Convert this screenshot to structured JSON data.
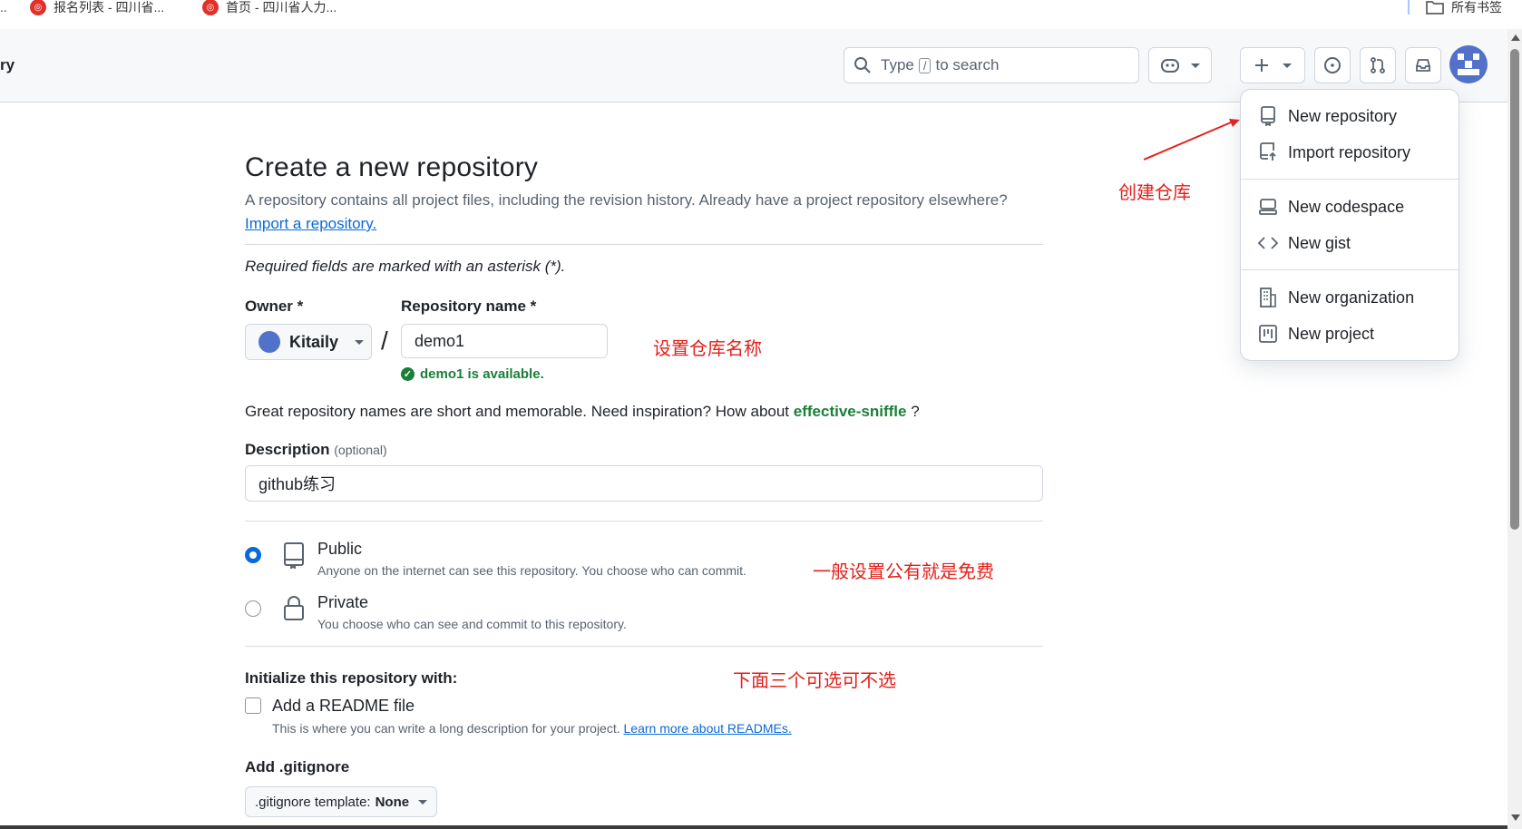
{
  "bookmarks": {
    "items": [
      {
        "label": "报名列表 - 四川省..."
      },
      {
        "label": "首页 - 四川省人力..."
      }
    ],
    "all_bookmarks": "所有书签"
  },
  "header": {
    "breadcrumb": "ry",
    "search_prefix": "Type",
    "search_key": "/",
    "search_suffix": "to search"
  },
  "menu": {
    "items": [
      {
        "label": "New repository",
        "icon": "repo-icon"
      },
      {
        "label": "Import repository",
        "icon": "repo-push-icon"
      },
      {
        "label": "New codespace",
        "icon": "codespace-icon"
      },
      {
        "label": "New gist",
        "icon": "code-icon"
      },
      {
        "label": "New organization",
        "icon": "organization-icon"
      },
      {
        "label": "New project",
        "icon": "project-icon"
      }
    ]
  },
  "form": {
    "title": "Create a new repository",
    "intro": "A repository contains all project files, including the revision history. Already have a project repository elsewhere?",
    "import_link": "Import a repository.",
    "required_note": "Required fields are marked with an asterisk (*).",
    "owner_label": "Owner *",
    "owner_value": "Kitaily",
    "slash": "/",
    "repo_name_label": "Repository name *",
    "repo_name_value": "demo1",
    "availability": "demo1 is available.",
    "hint_prefix": "Great repository names are short and memorable. Need inspiration? How about",
    "hint_suggestion": "effective-sniffle",
    "hint_suffix": "?",
    "description_label": "Description",
    "description_optional": "(optional)",
    "description_value": "github练习",
    "visibility": {
      "public_title": "Public",
      "public_desc": "Anyone on the internet can see this repository. You choose who can commit.",
      "private_title": "Private",
      "private_desc": "You choose who can see and commit to this repository.",
      "selected": "Public"
    },
    "init_label": "Initialize this repository with:",
    "readme_label": "Add a README file",
    "readme_checked": false,
    "readme_desc": "This is where you can write a long description for your project.",
    "readme_link": "Learn more about READMEs.",
    "gitignore_label": "Add .gitignore",
    "gitignore_select_prefix": ".gitignore template:",
    "gitignore_select_value": "None"
  },
  "annotations": {
    "create_repo": "创建仓库",
    "set_name": "设置仓库名称",
    "public_free": "一般设置公有就是免费",
    "optional_three": "下面三个可选可不选"
  },
  "colors": {
    "accent": "#0969da",
    "success": "#1a7f37",
    "annotation_red": "#e3201b"
  }
}
